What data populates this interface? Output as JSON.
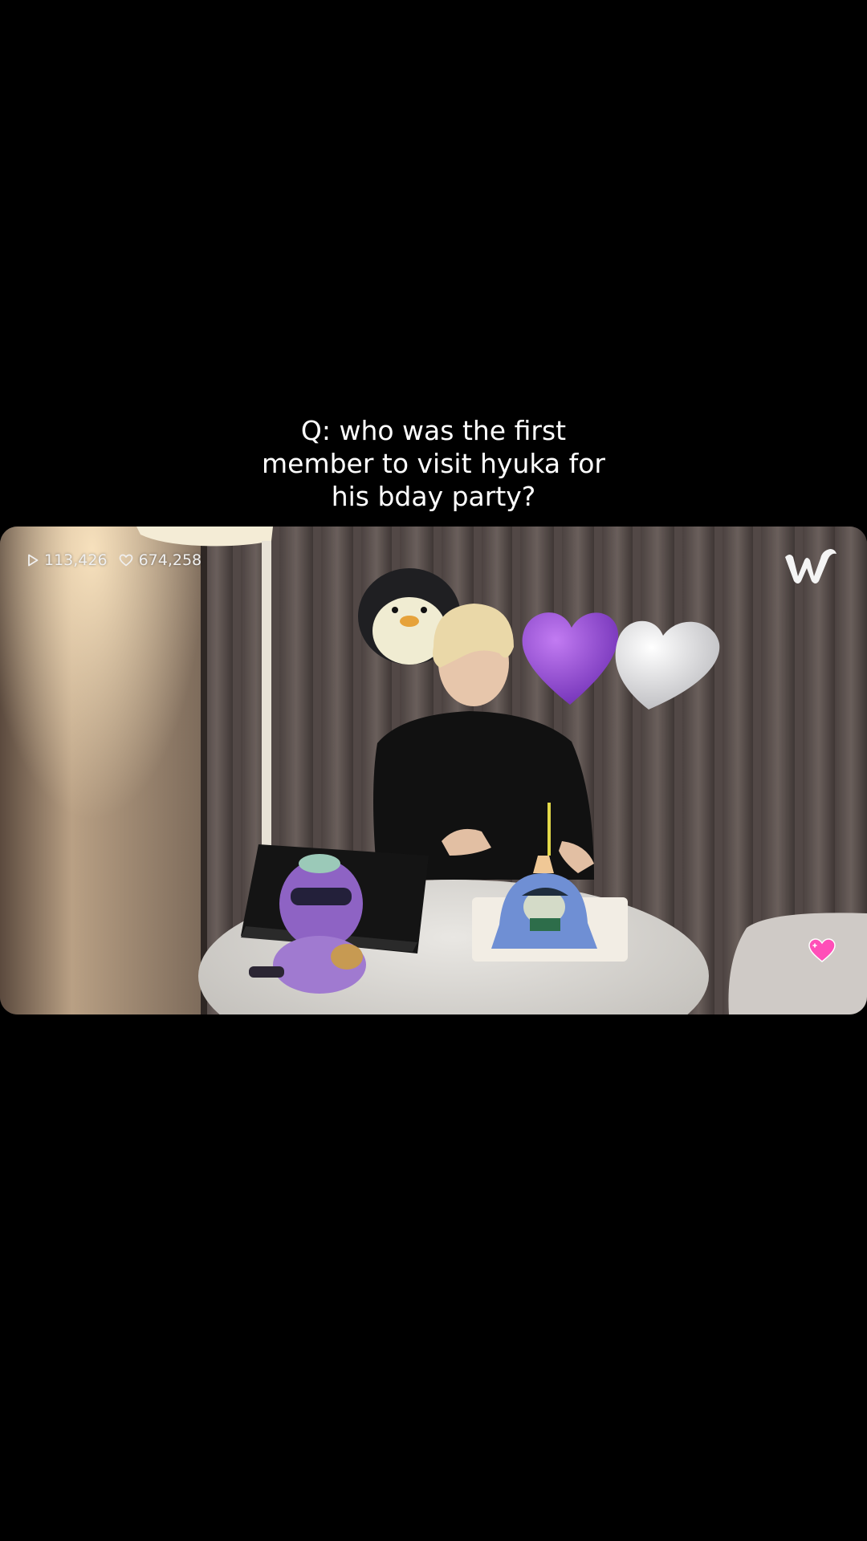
{
  "caption": {
    "lines": [
      "Q: who was the first",
      "member to visit hyuka for",
      "his bday party?"
    ]
  },
  "video": {
    "stats": {
      "plays": "113,426",
      "likes": "674,258",
      "play_icon": "play-outline-icon",
      "like_icon": "heart-outline-icon"
    },
    "logo": "weverse-w-logo",
    "reaction_icon": "pink-heart-icon",
    "colors": {
      "background": "#000000",
      "text": "#ffffff",
      "reaction_pink": "#ff4fb8",
      "balloon_purple": "#8a3fd1"
    }
  }
}
